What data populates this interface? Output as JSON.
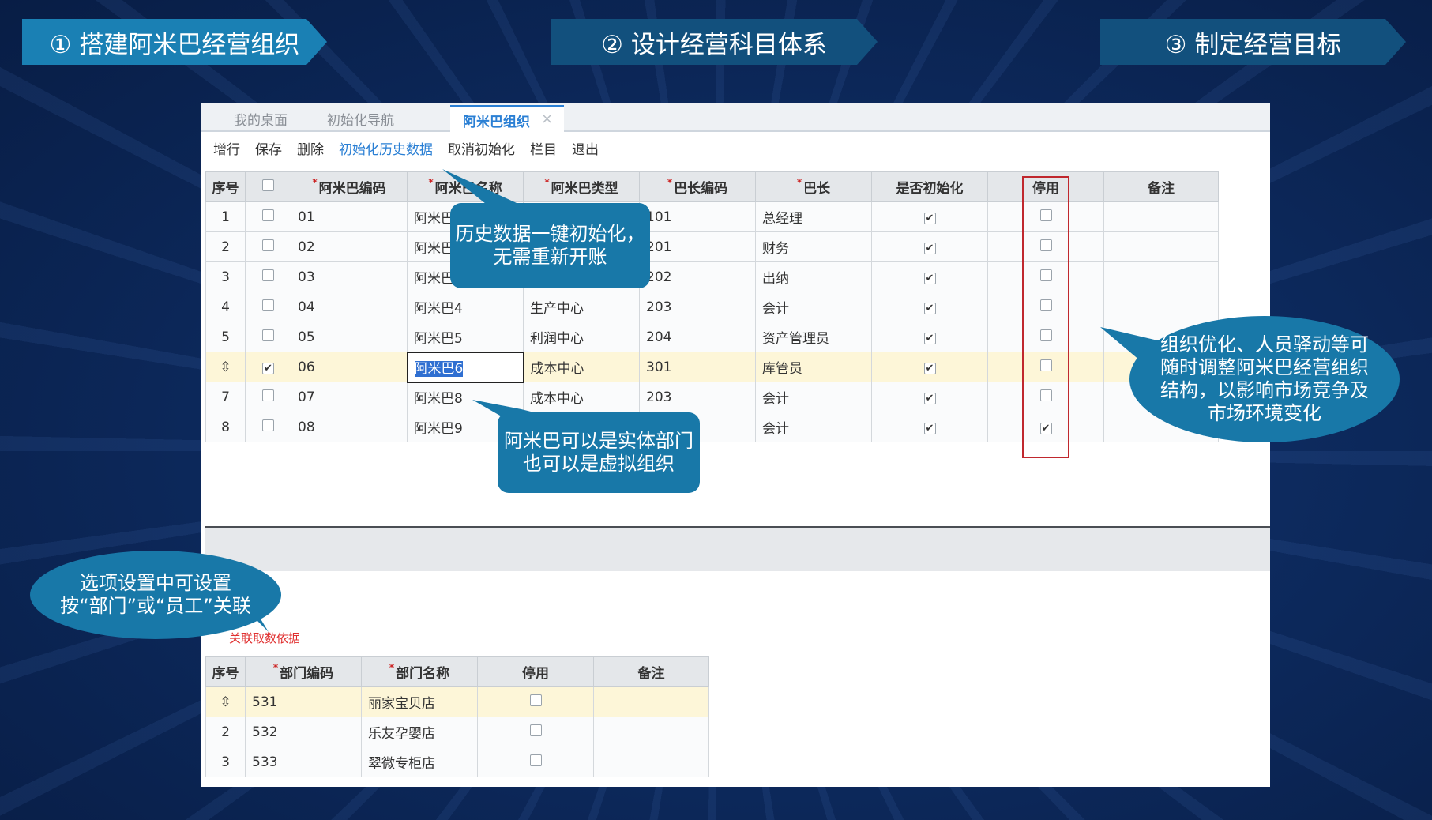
{
  "steps": [
    {
      "label": "① 搭建阿米巴经营组织"
    },
    {
      "label": "② 设计经营科目体系"
    },
    {
      "label": "③ 制定经营目标"
    }
  ],
  "tabs": {
    "desk": "我的桌面",
    "guide": "初始化导航",
    "active": "阿米巴组织",
    "close": "×"
  },
  "toolbar": {
    "add": "增行",
    "save": "保存",
    "delete": "删除",
    "init_history": "初始化历史数据",
    "cancel_init": "取消初始化",
    "columns": "栏目",
    "exit": "退出"
  },
  "main_table": {
    "headers": [
      "序号",
      "",
      "阿米巴编码",
      "阿米巴名称",
      "阿米巴类型",
      "巴长编码",
      "巴长",
      "是否初始化",
      "停用",
      "备注"
    ],
    "required_mark": "*",
    "rows": [
      {
        "no": "1",
        "code": "01",
        "name": "阿米巴",
        "type": "",
        "leader_code": "101",
        "leader": "总经理",
        "init": true,
        "disabled": false
      },
      {
        "no": "2",
        "code": "02",
        "name": "阿米巴",
        "type": "",
        "leader_code": "201",
        "leader": "财务",
        "init": true,
        "disabled": false
      },
      {
        "no": "3",
        "code": "03",
        "name": "阿米巴",
        "type": "",
        "leader_code": "202",
        "leader": "出纳",
        "init": true,
        "disabled": false
      },
      {
        "no": "4",
        "code": "04",
        "name": "阿米巴4",
        "type": "生产中心",
        "leader_code": "203",
        "leader": "会计",
        "init": true,
        "disabled": false
      },
      {
        "no": "5",
        "code": "05",
        "name": "阿米巴5",
        "type": "利润中心",
        "leader_code": "204",
        "leader": "资产管理员",
        "init": true,
        "disabled": false
      },
      {
        "no": "",
        "code": "06",
        "name": "阿米巴6",
        "type": "成本中心",
        "leader_code": "301",
        "leader": "库管员",
        "init": true,
        "disabled": false,
        "selected": true
      },
      {
        "no": "7",
        "code": "07",
        "name": "阿米巴8",
        "type": "成本中心",
        "leader_code": "203",
        "leader": "会计",
        "init": true,
        "disabled": false
      },
      {
        "no": "8",
        "code": "08",
        "name": "阿米巴9",
        "type": "",
        "leader_code": "",
        "leader": "会计",
        "init": true,
        "disabled": true
      }
    ]
  },
  "link_label": "关联取数依据",
  "sub_table": {
    "headers": [
      "序号",
      "部门编码",
      "部门名称",
      "停用",
      "备注"
    ],
    "rows": [
      {
        "no": "",
        "code": "531",
        "name": "丽家宝贝店",
        "disabled": false,
        "selected": true
      },
      {
        "no": "2",
        "code": "532",
        "name": "乐友孕婴店",
        "disabled": false
      },
      {
        "no": "3",
        "code": "533",
        "name": "翠微专柜店",
        "disabled": false
      }
    ]
  },
  "callouts": {
    "history": "历史数据一键初始化，无需重新开账",
    "entity": "阿米巴可以是实体部门也可以是虚拟组织",
    "optimize": "组织优化、人员驿动等可随时调整阿米巴经营组织结构，以影响市场竞争及市场环境变化",
    "options": "选项设置中可设置按“部门”或“员工”关联"
  },
  "colors": {
    "ribbon_active": "#1a80b4",
    "ribbon": "#12507d",
    "callout": "#1878a8",
    "highlight_row": "#fdf6d8",
    "red_box": "#c0282e"
  }
}
